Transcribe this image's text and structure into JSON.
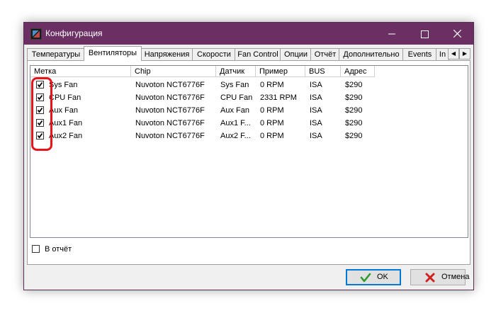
{
  "window": {
    "title": "Конфигурация"
  },
  "tabs": [
    {
      "label": "Температуры"
    },
    {
      "label": "Вентиляторы"
    },
    {
      "label": "Напряжения"
    },
    {
      "label": "Скорости"
    },
    {
      "label": "Fan Control"
    },
    {
      "label": "Опции"
    },
    {
      "label": "Отчёт"
    },
    {
      "label": "Дополнительно"
    },
    {
      "label": "Events"
    },
    {
      "label": "In"
    }
  ],
  "active_tab": "Вентиляторы",
  "table": {
    "columns": [
      "Метка",
      "Chip",
      "Датчик",
      "Пример",
      "BUS",
      "Адрес"
    ],
    "rows": [
      {
        "checked": true,
        "label": "Sys Fan",
        "chip": "Nuvoton NCT6776F",
        "sensor": "Sys Fan",
        "sample": "0 RPM",
        "bus": "ISA",
        "address": "$290"
      },
      {
        "checked": true,
        "label": "CPU Fan",
        "chip": "Nuvoton NCT6776F",
        "sensor": "CPU Fan",
        "sample": "2331 RPM",
        "bus": "ISA",
        "address": "$290"
      },
      {
        "checked": true,
        "label": "Aux Fan",
        "chip": "Nuvoton NCT6776F",
        "sensor": "Aux Fan",
        "sample": "0 RPM",
        "bus": "ISA",
        "address": "$290"
      },
      {
        "checked": true,
        "label": "Aux1 Fan",
        "chip": "Nuvoton NCT6776F",
        "sensor": "Aux1 F...",
        "sample": "0 RPM",
        "bus": "ISA",
        "address": "$290"
      },
      {
        "checked": true,
        "label": "Aux2 Fan",
        "chip": "Nuvoton NCT6776F",
        "sensor": "Aux2 F...",
        "sample": "0 RPM",
        "bus": "ISA",
        "address": "$290"
      }
    ]
  },
  "report_checkbox": {
    "label": "В отчёт",
    "checked": false
  },
  "buttons": {
    "ok": "OK",
    "cancel": "Отмена"
  },
  "colors": {
    "titlebar": "#6b2f63",
    "highlight": "#e8141b",
    "ok_check": "#2d9b2d",
    "cancel_x": "#d02020"
  }
}
